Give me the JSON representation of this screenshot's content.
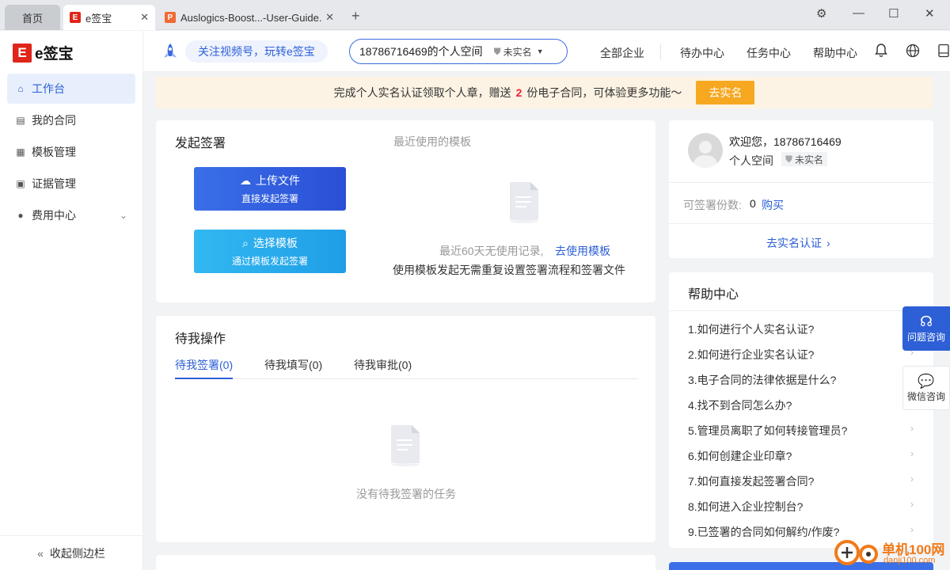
{
  "tabs": {
    "home": "首页",
    "active": "e签宝",
    "other": "Auslogics-Boost...-User-Guide."
  },
  "sidebar": {
    "logo_text": "e签宝",
    "items": [
      {
        "label": "工作台",
        "icon": "home-icon"
      },
      {
        "label": "我的合同",
        "icon": "contract-icon"
      },
      {
        "label": "模板管理",
        "icon": "template-icon"
      },
      {
        "label": "证据管理",
        "icon": "bookmark-icon"
      },
      {
        "label": "费用中心",
        "icon": "cost-icon"
      }
    ],
    "collapse": "收起侧边栏"
  },
  "header": {
    "promo": "关注视频号，玩转e签宝",
    "space": "18786716469的个人空间",
    "space_status": "未实名",
    "nav": [
      "全部企业",
      "待办中心",
      "任务中心",
      "帮助中心"
    ]
  },
  "banner": {
    "text_a": "完成个人实名认证领取个人章，赠送",
    "num": "2",
    "text_b": "份电子合同，可体验更多功能～",
    "button": "去实名"
  },
  "sign": {
    "title": "发起签署",
    "upload_title": "上传文件",
    "upload_sub": "直接发起签署",
    "template_title": "选择模板",
    "template_sub": "通过模板发起签署",
    "recent_title": "最近使用的模板",
    "recent_empty": "最近60天无使用记录,",
    "recent_link": "去使用模板",
    "recent_desc": "使用模板发起无需重复设置签署流程和签署文件"
  },
  "todo": {
    "title": "待我操作",
    "tabs": [
      "待我签署(0)",
      "待我填写(0)",
      "待我审批(0)"
    ],
    "empty": "没有待我签署的任务"
  },
  "profile": {
    "welcome": "欢迎您，18786716469",
    "space": "个人空间",
    "status": "未实名",
    "quota_label": "可签署份数:",
    "quota_value": "0",
    "buy": "购买",
    "verify": "去实名认证"
  },
  "help": {
    "title": "帮助中心",
    "items": [
      "1.如何进行个人实名认证?",
      "2.如何进行企业实名认证?",
      "3.电子合同的法律依据是什么?",
      "4.找不到合同怎么办?",
      "5.管理员离职了如何转接管理员?",
      "6.如何创建企业印章?",
      "7.如何直接发起签署合同?",
      "8.如何进入企业控制台?",
      "9.已签署的合同如何解约/作废?"
    ]
  },
  "float": {
    "consult": "问题咨询",
    "wechat": "微信咨询"
  },
  "watermark": {
    "name": "单机100网",
    "url": "danji100.com"
  },
  "colors": {
    "primary": "#2d5fd6",
    "brand_red": "#e0251b",
    "orange": "#f6a821"
  }
}
